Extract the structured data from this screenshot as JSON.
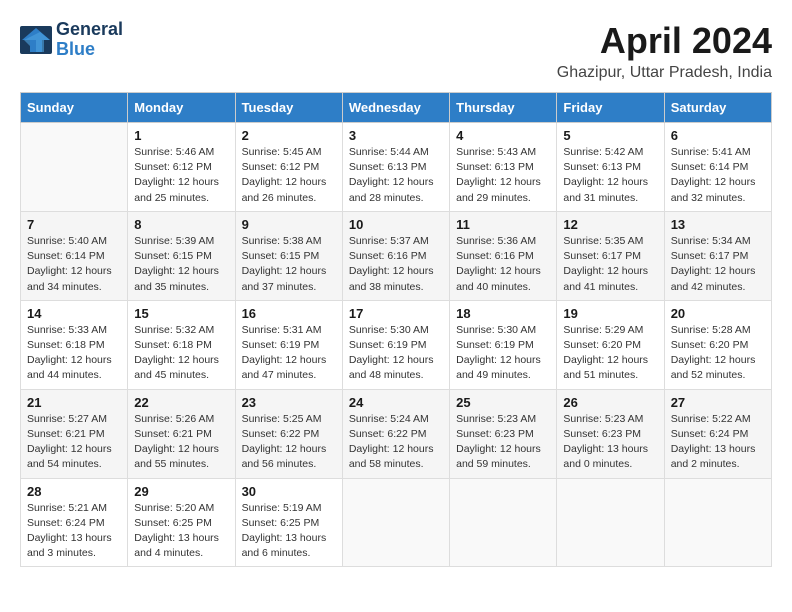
{
  "logo": {
    "line1": "General",
    "line2": "Blue"
  },
  "title": "April 2024",
  "subtitle": "Ghazipur, Uttar Pradesh, India",
  "days_of_week": [
    "Sunday",
    "Monday",
    "Tuesday",
    "Wednesday",
    "Thursday",
    "Friday",
    "Saturday"
  ],
  "weeks": [
    [
      {
        "day": "",
        "info": ""
      },
      {
        "day": "1",
        "info": "Sunrise: 5:46 AM\nSunset: 6:12 PM\nDaylight: 12 hours\nand 25 minutes."
      },
      {
        "day": "2",
        "info": "Sunrise: 5:45 AM\nSunset: 6:12 PM\nDaylight: 12 hours\nand 26 minutes."
      },
      {
        "day": "3",
        "info": "Sunrise: 5:44 AM\nSunset: 6:13 PM\nDaylight: 12 hours\nand 28 minutes."
      },
      {
        "day": "4",
        "info": "Sunrise: 5:43 AM\nSunset: 6:13 PM\nDaylight: 12 hours\nand 29 minutes."
      },
      {
        "day": "5",
        "info": "Sunrise: 5:42 AM\nSunset: 6:13 PM\nDaylight: 12 hours\nand 31 minutes."
      },
      {
        "day": "6",
        "info": "Sunrise: 5:41 AM\nSunset: 6:14 PM\nDaylight: 12 hours\nand 32 minutes."
      }
    ],
    [
      {
        "day": "7",
        "info": "Sunrise: 5:40 AM\nSunset: 6:14 PM\nDaylight: 12 hours\nand 34 minutes."
      },
      {
        "day": "8",
        "info": "Sunrise: 5:39 AM\nSunset: 6:15 PM\nDaylight: 12 hours\nand 35 minutes."
      },
      {
        "day": "9",
        "info": "Sunrise: 5:38 AM\nSunset: 6:15 PM\nDaylight: 12 hours\nand 37 minutes."
      },
      {
        "day": "10",
        "info": "Sunrise: 5:37 AM\nSunset: 6:16 PM\nDaylight: 12 hours\nand 38 minutes."
      },
      {
        "day": "11",
        "info": "Sunrise: 5:36 AM\nSunset: 6:16 PM\nDaylight: 12 hours\nand 40 minutes."
      },
      {
        "day": "12",
        "info": "Sunrise: 5:35 AM\nSunset: 6:17 PM\nDaylight: 12 hours\nand 41 minutes."
      },
      {
        "day": "13",
        "info": "Sunrise: 5:34 AM\nSunset: 6:17 PM\nDaylight: 12 hours\nand 42 minutes."
      }
    ],
    [
      {
        "day": "14",
        "info": "Sunrise: 5:33 AM\nSunset: 6:18 PM\nDaylight: 12 hours\nand 44 minutes."
      },
      {
        "day": "15",
        "info": "Sunrise: 5:32 AM\nSunset: 6:18 PM\nDaylight: 12 hours\nand 45 minutes."
      },
      {
        "day": "16",
        "info": "Sunrise: 5:31 AM\nSunset: 6:19 PM\nDaylight: 12 hours\nand 47 minutes."
      },
      {
        "day": "17",
        "info": "Sunrise: 5:30 AM\nSunset: 6:19 PM\nDaylight: 12 hours\nand 48 minutes."
      },
      {
        "day": "18",
        "info": "Sunrise: 5:30 AM\nSunset: 6:19 PM\nDaylight: 12 hours\nand 49 minutes."
      },
      {
        "day": "19",
        "info": "Sunrise: 5:29 AM\nSunset: 6:20 PM\nDaylight: 12 hours\nand 51 minutes."
      },
      {
        "day": "20",
        "info": "Sunrise: 5:28 AM\nSunset: 6:20 PM\nDaylight: 12 hours\nand 52 minutes."
      }
    ],
    [
      {
        "day": "21",
        "info": "Sunrise: 5:27 AM\nSunset: 6:21 PM\nDaylight: 12 hours\nand 54 minutes."
      },
      {
        "day": "22",
        "info": "Sunrise: 5:26 AM\nSunset: 6:21 PM\nDaylight: 12 hours\nand 55 minutes."
      },
      {
        "day": "23",
        "info": "Sunrise: 5:25 AM\nSunset: 6:22 PM\nDaylight: 12 hours\nand 56 minutes."
      },
      {
        "day": "24",
        "info": "Sunrise: 5:24 AM\nSunset: 6:22 PM\nDaylight: 12 hours\nand 58 minutes."
      },
      {
        "day": "25",
        "info": "Sunrise: 5:23 AM\nSunset: 6:23 PM\nDaylight: 12 hours\nand 59 minutes."
      },
      {
        "day": "26",
        "info": "Sunrise: 5:23 AM\nSunset: 6:23 PM\nDaylight: 13 hours\nand 0 minutes."
      },
      {
        "day": "27",
        "info": "Sunrise: 5:22 AM\nSunset: 6:24 PM\nDaylight: 13 hours\nand 2 minutes."
      }
    ],
    [
      {
        "day": "28",
        "info": "Sunrise: 5:21 AM\nSunset: 6:24 PM\nDaylight: 13 hours\nand 3 minutes."
      },
      {
        "day": "29",
        "info": "Sunrise: 5:20 AM\nSunset: 6:25 PM\nDaylight: 13 hours\nand 4 minutes."
      },
      {
        "day": "30",
        "info": "Sunrise: 5:19 AM\nSunset: 6:25 PM\nDaylight: 13 hours\nand 6 minutes."
      },
      {
        "day": "",
        "info": ""
      },
      {
        "day": "",
        "info": ""
      },
      {
        "day": "",
        "info": ""
      },
      {
        "day": "",
        "info": ""
      }
    ]
  ]
}
